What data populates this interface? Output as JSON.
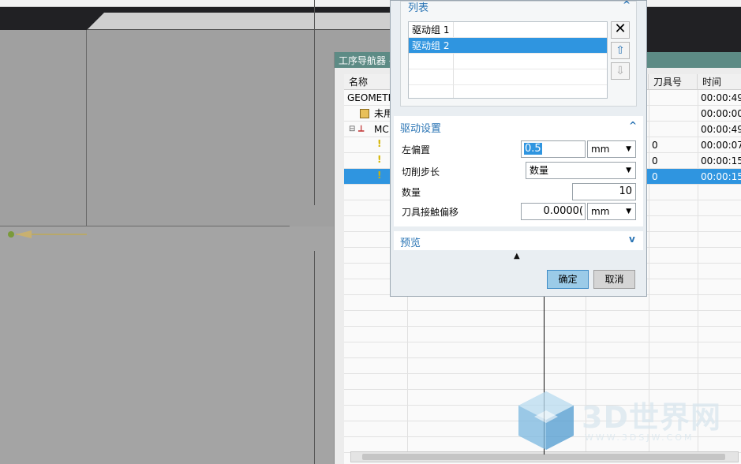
{
  "navigator": {
    "title": "工序导航器 -",
    "columns": [
      "名称",
      "刀具号",
      "时间"
    ],
    "rows": [
      {
        "name": "GEOMETI",
        "tool": "",
        "time": "00:00:49",
        "selected": false
      },
      {
        "name": "未用",
        "tool": "",
        "time": "00:00:00",
        "selected": false
      },
      {
        "name": "MC",
        "tool": "",
        "time": "00:00:49",
        "selected": false
      },
      {
        "name": "",
        "tool": "0",
        "time": "00:00:07",
        "selected": false
      },
      {
        "name": "",
        "tool": "0",
        "time": "00:00:15",
        "selected": false
      },
      {
        "name": "",
        "tool": "0",
        "time": "00:00:15",
        "selected": true
      }
    ]
  },
  "dialog": {
    "list_section": {
      "title": "列表",
      "items": [
        "驱动组 1",
        "驱动组 2"
      ],
      "selected_index": 1
    },
    "drive_section": {
      "title": "驱动设置",
      "left_offset_label": "左偏置",
      "left_offset_value": "0.5",
      "left_offset_unit": "mm",
      "cut_step_label": "切削步长",
      "cut_step_value": "数量",
      "count_label": "数量",
      "count_value": "10",
      "tool_contact_offset_label": "刀具接触偏移",
      "tool_contact_offset_value": "0.0000(",
      "tool_contact_offset_unit": "mm"
    },
    "preview_section": {
      "title": "预览"
    },
    "ok_label": "确定",
    "cancel_label": "取消"
  },
  "watermark": {
    "brand": "3D世界网",
    "url": "WWW.3DSJW.COM"
  },
  "colors": {
    "selection": "#2f95e0",
    "section_title": "#2a74b4",
    "navigator_titlebar": "#5d8b85"
  }
}
